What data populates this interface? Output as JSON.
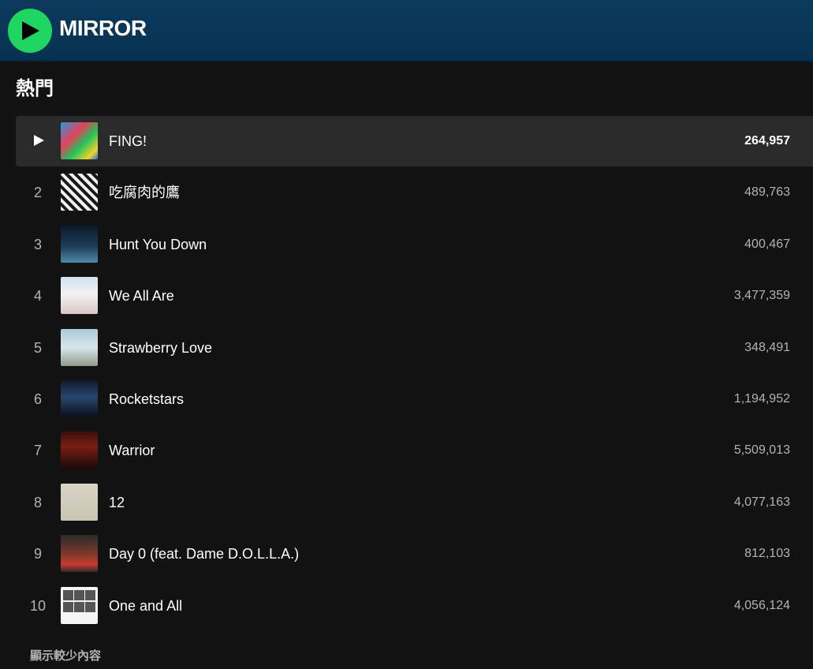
{
  "artist": {
    "name": "MIRROR"
  },
  "section": {
    "title": "熱門"
  },
  "tracks": [
    {
      "rank": "1",
      "title": "FING!",
      "plays": "264,957",
      "cover_icon": "album-cover"
    },
    {
      "rank": "2",
      "title": "吃腐肉的鷹",
      "plays": "489,763",
      "cover_icon": "album-cover"
    },
    {
      "rank": "3",
      "title": "Hunt You Down",
      "plays": "400,467",
      "cover_icon": "album-cover"
    },
    {
      "rank": "4",
      "title": "We All Are",
      "plays": "3,477,359",
      "cover_icon": "album-cover"
    },
    {
      "rank": "5",
      "title": "Strawberry Love",
      "plays": "348,491",
      "cover_icon": "album-cover"
    },
    {
      "rank": "6",
      "title": "Rocketstars",
      "plays": "1,194,952",
      "cover_icon": "album-cover"
    },
    {
      "rank": "7",
      "title": "Warrior",
      "plays": "5,509,013",
      "cover_icon": "album-cover"
    },
    {
      "rank": "8",
      "title": "12",
      "plays": "4,077,163",
      "cover_icon": "album-cover"
    },
    {
      "rank": "9",
      "title": "Day 0 (feat. Dame D.O.L.L.A.)",
      "plays": "812,103",
      "cover_icon": "album-cover"
    },
    {
      "rank": "10",
      "title": "One and All",
      "plays": "4,056,124",
      "cover_icon": "album-cover"
    }
  ],
  "show_less": {
    "label": "顯示較少內容"
  },
  "colors": {
    "accent": "#1ed760",
    "header_bg": "#0c3a5c",
    "page_bg": "#121212",
    "active_row": "#2a2a2a"
  }
}
